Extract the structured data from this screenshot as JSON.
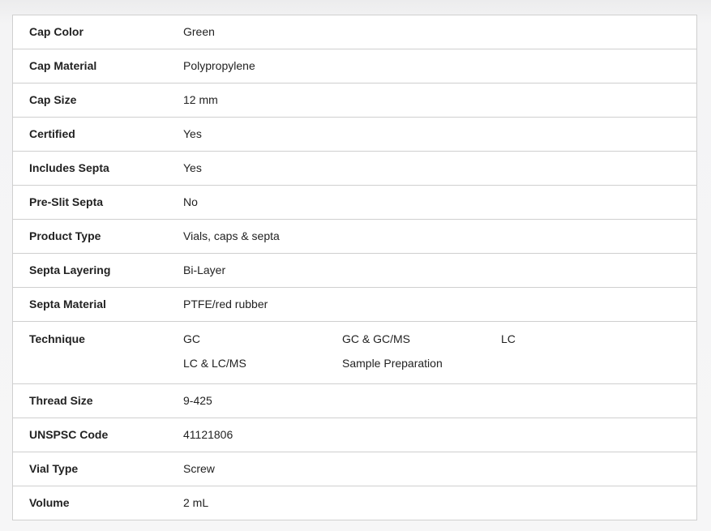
{
  "specs": [
    {
      "label": "Cap Color",
      "value": "Green"
    },
    {
      "label": "Cap Material",
      "value": "Polypropylene"
    },
    {
      "label": "Cap Size",
      "value": "12 mm"
    },
    {
      "label": "Certified",
      "value": "Yes"
    },
    {
      "label": "Includes Septa",
      "value": "Yes"
    },
    {
      "label": "Pre-Slit Septa",
      "value": "No"
    },
    {
      "label": "Product Type",
      "value": "Vials, caps & septa"
    },
    {
      "label": "Septa Layering",
      "value": "Bi-Layer"
    },
    {
      "label": "Septa Material",
      "value": "PTFE/red rubber"
    },
    {
      "label": "Technique",
      "values": [
        "GC",
        "GC & GC/MS",
        "LC",
        "LC & LC/MS",
        "Sample Preparation"
      ]
    },
    {
      "label": "Thread Size",
      "value": "9-425"
    },
    {
      "label": "UNSPSC Code",
      "value": "41121806"
    },
    {
      "label": "Vial Type",
      "value": "Screw"
    },
    {
      "label": "Volume",
      "value": "2 mL"
    }
  ]
}
